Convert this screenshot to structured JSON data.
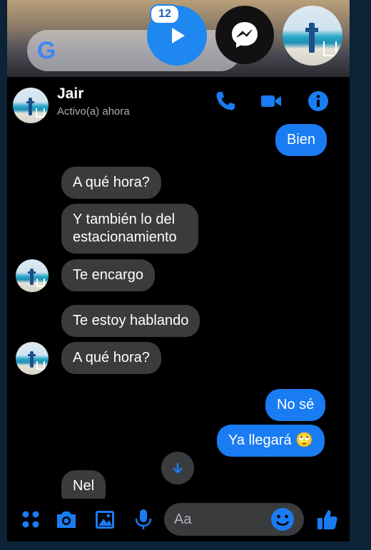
{
  "home": {
    "google_letter": "G",
    "notification_count": "12"
  },
  "header": {
    "name": "Jair",
    "status": "Activo(a) ahora"
  },
  "messages": [
    {
      "from": "me",
      "text": "Bien"
    },
    {
      "from": "them",
      "text": "A qué hora?"
    },
    {
      "from": "them",
      "text": "Y también lo del estacionamiento"
    },
    {
      "from": "them",
      "text": "Te encargo"
    },
    {
      "from": "them",
      "text": "Te estoy hablando"
    },
    {
      "from": "them",
      "text": "A qué hora?"
    },
    {
      "from": "me",
      "text": "No sé"
    },
    {
      "from": "me",
      "text": "Ya llegará 🙄"
    },
    {
      "from": "them",
      "text": "Nel"
    }
  ],
  "composer": {
    "placeholder": "Aa"
  },
  "colors": {
    "accent": "#1a7cf2",
    "incoming_bubble": "#3a3b3d",
    "background": "#000000"
  },
  "icons": [
    "google-logo",
    "play-icon",
    "messenger-icon",
    "phone-icon",
    "video-camera-icon",
    "info-icon",
    "arrow-down-icon",
    "menu-dots-icon",
    "camera-icon",
    "image-icon",
    "microphone-icon",
    "emoji-icon",
    "thumbs-up-icon"
  ]
}
